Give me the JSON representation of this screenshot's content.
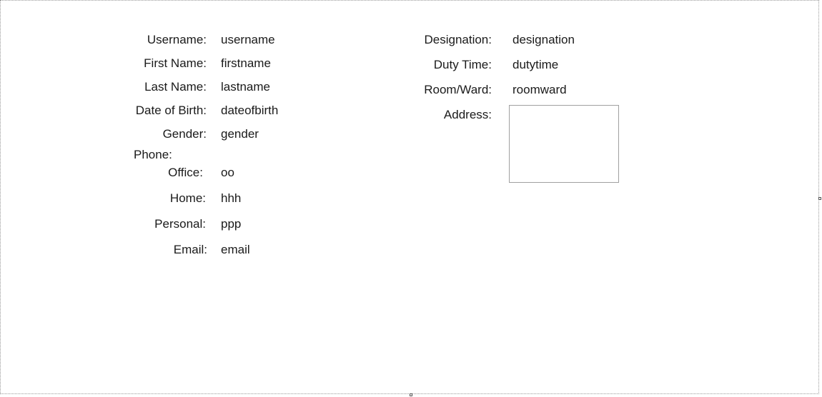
{
  "left_fields": {
    "username": {
      "label": "Username:",
      "value": "username"
    },
    "first_name": {
      "label": "First Name:",
      "value": "firstname"
    },
    "last_name": {
      "label": "Last Name:",
      "value": "lastname"
    },
    "date_of_birth": {
      "label": "Date of Birth:",
      "value": "dateofbirth"
    },
    "gender": {
      "label": "Gender:",
      "value": "gender"
    },
    "phone_header": "Phone:",
    "office": {
      "label": "Office:",
      "value": "oo"
    },
    "home": {
      "label": "Home:",
      "value": "hhh"
    },
    "personal": {
      "label": "Personal:",
      "value": "ppp"
    },
    "email": {
      "label": "Email:",
      "value": "email"
    }
  },
  "right_fields": {
    "designation": {
      "label": "Designation:",
      "value": "designation"
    },
    "duty_time": {
      "label": "Duty Time:",
      "value": "dutytime"
    },
    "room_ward": {
      "label": "Room/Ward:",
      "value": "roomward"
    },
    "address": {
      "label": "Address:",
      "value": ""
    }
  }
}
